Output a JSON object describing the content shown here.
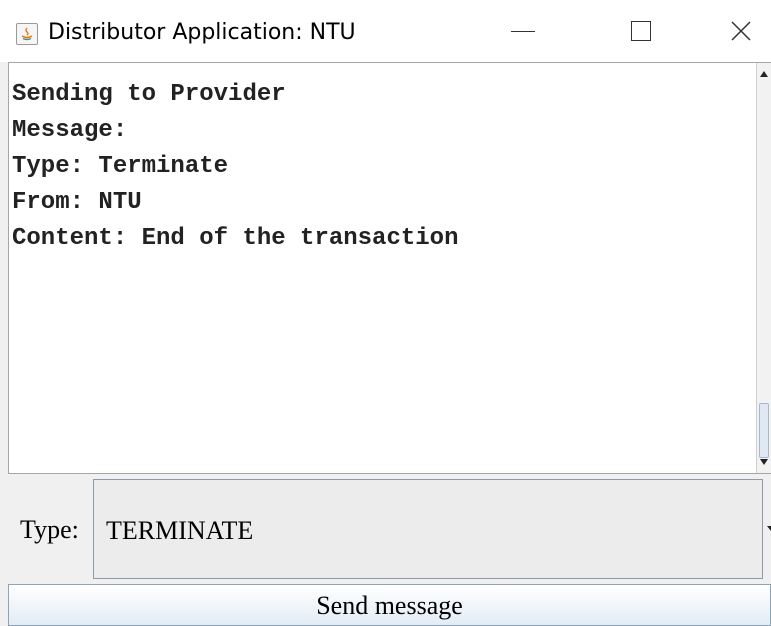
{
  "window": {
    "title": "Distributor Application: NTU",
    "controls": {
      "minimize": "minimize",
      "maximize": "maximize",
      "close": "×"
    }
  },
  "output": {
    "lines": [
      "Sending to Provider",
      "Message:",
      "Type: Terminate",
      "From: NTU",
      "Content: End of the transaction"
    ]
  },
  "type_selector": {
    "label": "Type:",
    "selected": "TERMINATE"
  },
  "send_button": {
    "label": "Send message"
  }
}
